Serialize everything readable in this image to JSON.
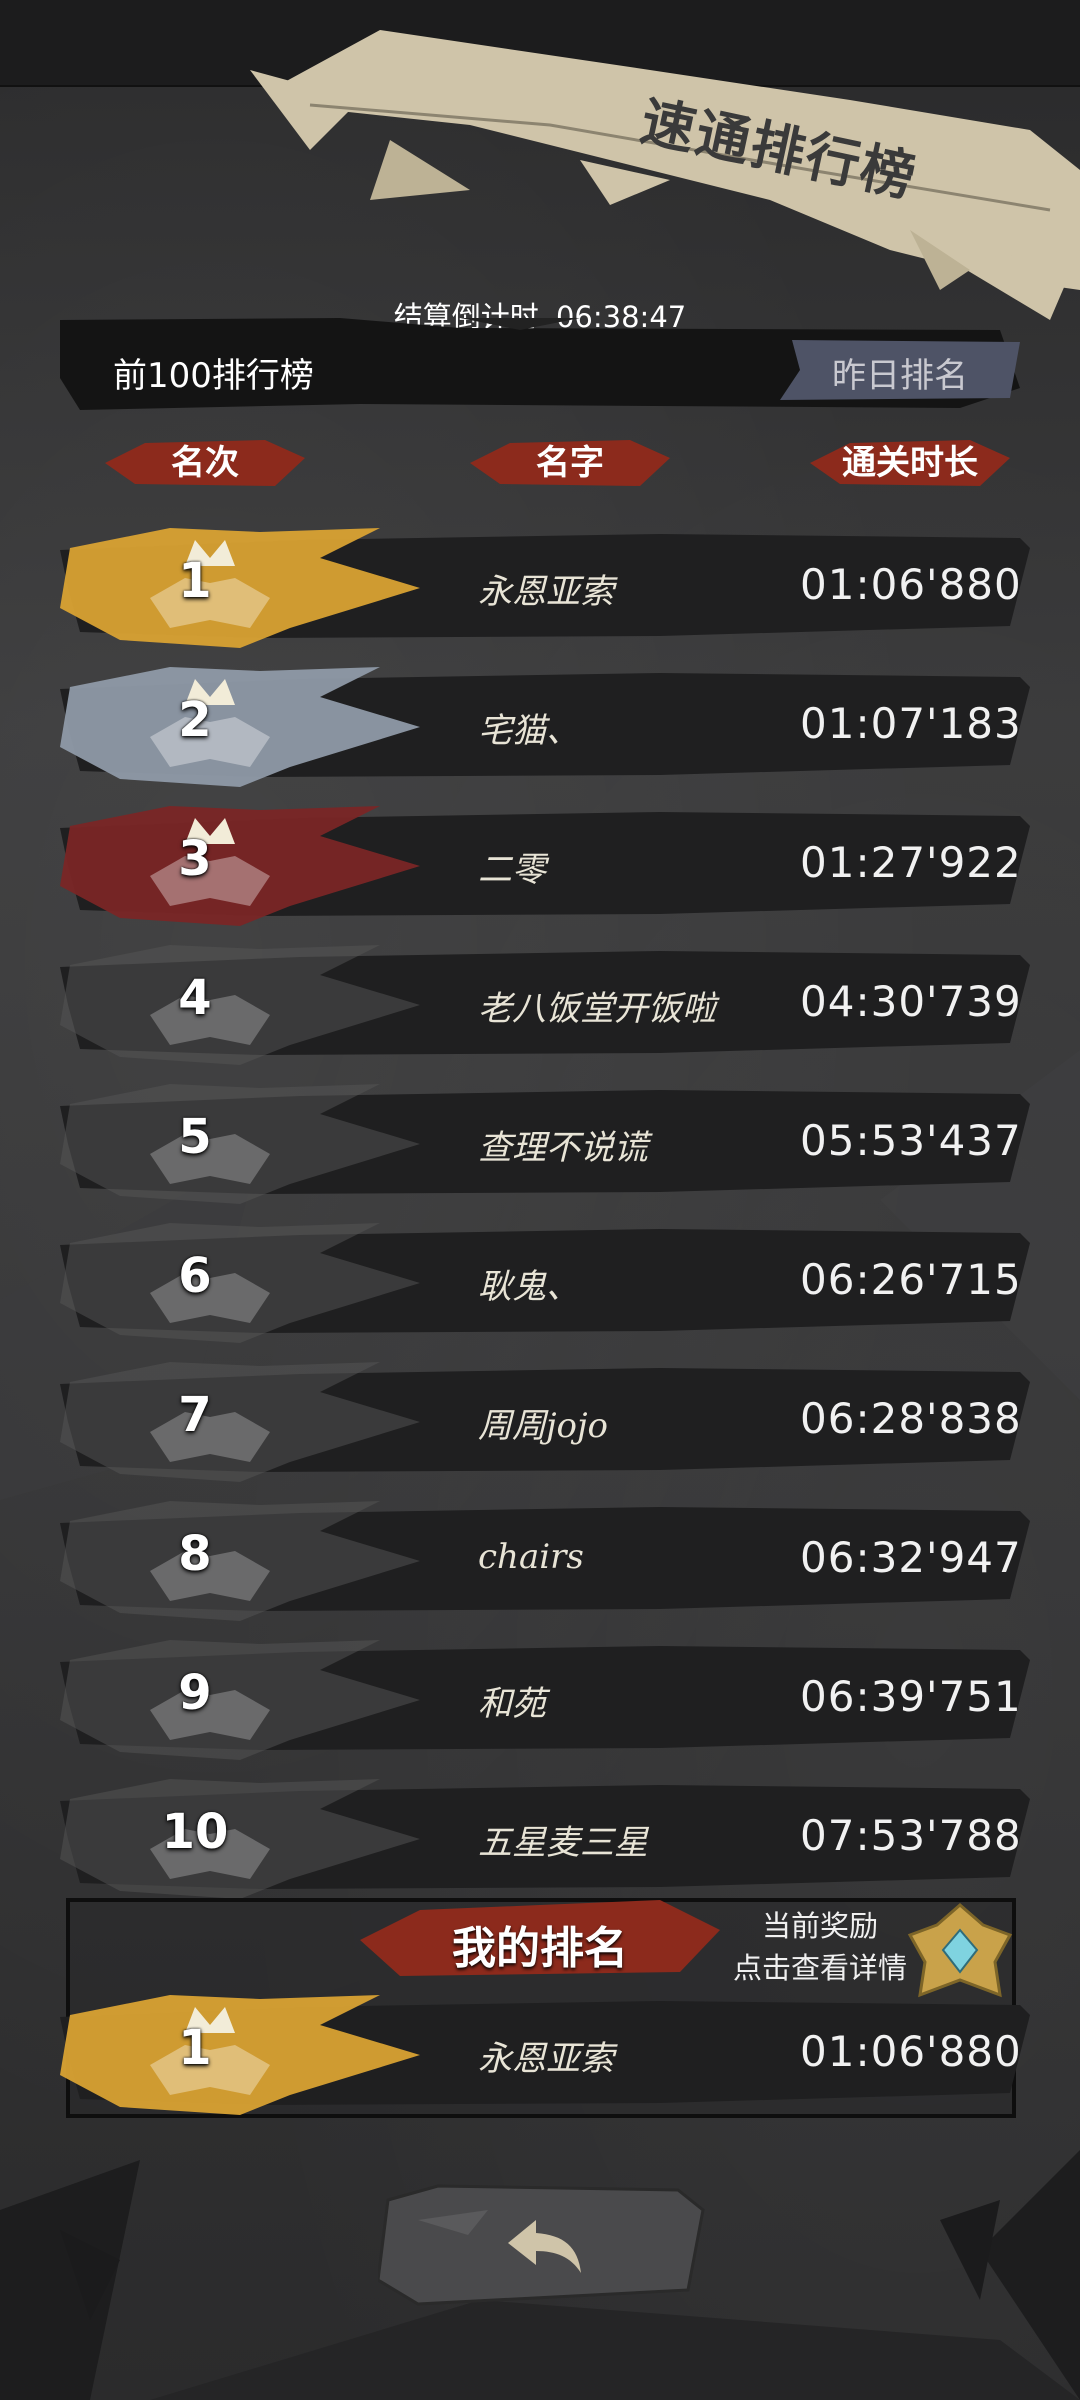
{
  "banner": {
    "title": "速通排行榜"
  },
  "countdown": {
    "label": "结算倒计时",
    "value": "06:38:47"
  },
  "leaderboard": {
    "title": "前100排行榜",
    "yesterday_button": "昨日排名",
    "columns": [
      "名次",
      "名字",
      "通关时长"
    ],
    "rows": [
      {
        "rank": "1",
        "name": "永恩亚索",
        "time": "01:06'880"
      },
      {
        "rank": "2",
        "name": "宅猫、",
        "time": "01:07'183"
      },
      {
        "rank": "3",
        "name": "二零",
        "time": "01:27'922"
      },
      {
        "rank": "4",
        "name": "老八饭堂开饭啦",
        "time": "04:30'739"
      },
      {
        "rank": "5",
        "name": "查理不说谎",
        "time": "05:53'437"
      },
      {
        "rank": "6",
        "name": "耿鬼、",
        "time": "06:26'715"
      },
      {
        "rank": "7",
        "name": "周周jojo",
        "time": "06:28'838"
      },
      {
        "rank": "8",
        "name": "chairs",
        "time": "06:32'947"
      },
      {
        "rank": "9",
        "name": "和苑",
        "time": "06:39'751"
      },
      {
        "rank": "10",
        "name": "五星麦三星",
        "time": "07:53'788"
      }
    ]
  },
  "my_rank": {
    "title": "我的排名",
    "reward_line1": "当前奖励",
    "reward_line2": "点击查看详情",
    "rank": "1",
    "name": "永恩亚索",
    "time": "01:06'880"
  },
  "colors": {
    "gold": "#d9a233",
    "silver": "#8f9aa8",
    "bronze": "#7a2626",
    "grey": "#555556",
    "accent_red": "#8c2a1c",
    "banner_beige": "#cfc4a9",
    "yesterday_bg": "#4e5366"
  },
  "icons": [
    "crown-icon",
    "back-arrow-icon",
    "reward-badge-icon"
  ]
}
